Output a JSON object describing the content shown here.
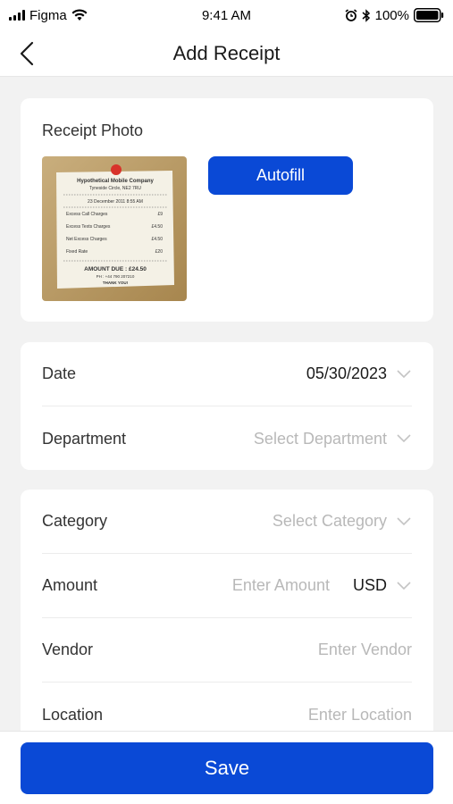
{
  "status_bar": {
    "carrier": "Figma",
    "time": "9:41 AM",
    "battery": "100%"
  },
  "nav": {
    "title": "Add Receipt",
    "back_icon": "chevron-left-icon"
  },
  "receipt_photo": {
    "label": "Receipt Photo",
    "autofill_label": "Autofill",
    "receipt": {
      "company": "Hypothetical Mobile Company",
      "address": "Tyneside Circle, NE2 7RU",
      "date": "23 December 2011 8:55 AM",
      "lines": [
        {
          "item": "Excess Call Charges",
          "amount": "£9"
        },
        {
          "item": "Excess Texts Charges",
          "amount": "£4.50"
        },
        {
          "item": "Net Excess Charges",
          "amount": "£4.50"
        },
        {
          "item": "Fixed Rate",
          "amount": "£20"
        }
      ],
      "amount_due": "AMOUNT DUE : £24.50",
      "phone": "PH : +44 790 207210",
      "thanks": "THANK YOU!"
    }
  },
  "form_group_1": {
    "date": {
      "label": "Date",
      "value": "05/30/2023"
    },
    "department": {
      "label": "Department",
      "placeholder": "Select Department"
    }
  },
  "form_group_2": {
    "category": {
      "label": "Category",
      "placeholder": "Select Category"
    },
    "amount": {
      "label": "Amount",
      "placeholder": "Enter Amount",
      "currency": "USD"
    },
    "vendor": {
      "label": "Vendor",
      "placeholder": "Enter Vendor"
    },
    "location": {
      "label": "Location",
      "placeholder": "Enter Location"
    }
  },
  "actions": {
    "save_label": "Save"
  },
  "colors": {
    "primary": "#0a49d6",
    "background": "#f2f2f2",
    "placeholder": "#b8b8b8"
  }
}
